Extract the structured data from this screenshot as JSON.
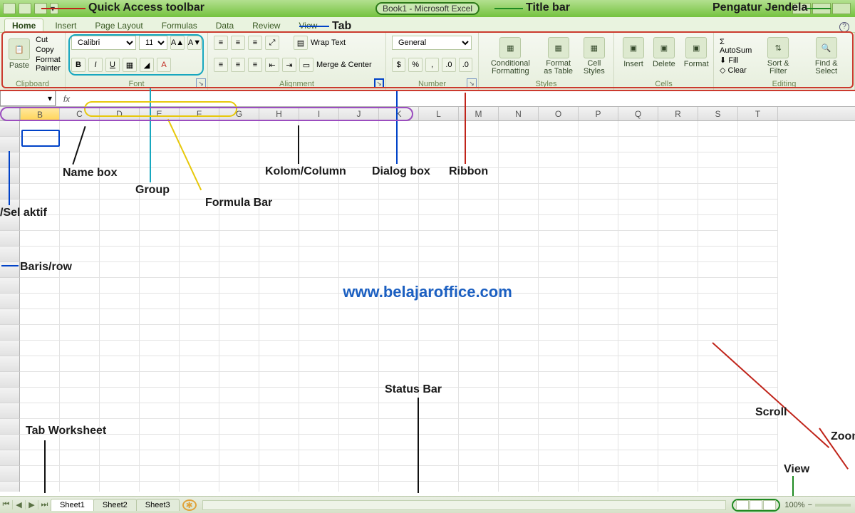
{
  "title_bar": {
    "document_title": "Book1 - Microsoft Excel",
    "qat_label_annotation": "Quick Access toolbar",
    "title_annotation": "Title bar",
    "window_controls_annotation": "Pengatur Jendela"
  },
  "tabs": {
    "annotation": "Tab",
    "items": [
      "Home",
      "Insert",
      "Page Layout",
      "Formulas",
      "Data",
      "Review",
      "View"
    ],
    "active_index": 0
  },
  "ribbon": {
    "clipboard": {
      "label": "Clipboard",
      "paste": "Paste",
      "cut": "Cut",
      "copy": "Copy",
      "format_painter": "Format Painter"
    },
    "font": {
      "label": "Font",
      "font_name": "Calibri",
      "font_size": "11",
      "bold": "B",
      "italic": "I",
      "underline": "U"
    },
    "alignment": {
      "label": "Alignment",
      "wrap_text": "Wrap Text",
      "merge_center": "Merge & Center"
    },
    "number": {
      "label": "Number",
      "format": "General"
    },
    "styles": {
      "label": "Styles",
      "conditional": "Conditional Formatting",
      "as_table": "Format as Table",
      "cell_styles": "Cell Styles"
    },
    "cells": {
      "label": "Cells",
      "insert": "Insert",
      "delete": "Delete",
      "format": "Format"
    },
    "editing": {
      "label": "Editing",
      "autosum": "AutoSum",
      "fill": "Fill",
      "clear": "Clear",
      "sort_filter": "Sort & Filter",
      "find_select": "Find & Select"
    },
    "annotation_ribbon": "Ribbon",
    "annotation_group": "Group",
    "annotation_dialog": "Dialog box"
  },
  "fx": {
    "namebox_value": "",
    "fx_symbol": "fx",
    "formula_value": "",
    "annotation_namebox": "Name box",
    "annotation_formula": "Formula Bar"
  },
  "grid": {
    "columns": [
      "B",
      "C",
      "D",
      "E",
      "F",
      "G",
      "H",
      "I",
      "J",
      "K",
      "L",
      "M",
      "N",
      "O",
      "P",
      "Q",
      "R",
      "S",
      "T"
    ],
    "selected_column_index": 0,
    "rows_visible": 24,
    "annotation_column": "Kolom/Column",
    "annotation_row": "Baris/row",
    "annotation_active_cell": "/Sel aktif",
    "watermark": "www.belajaroffice.com"
  },
  "footer": {
    "sheets": [
      "Sheet1",
      "Sheet2",
      "Sheet3"
    ],
    "active_sheet_index": 0,
    "zoom": "100%",
    "annotation_tabs": "Tab Worksheet",
    "annotation_status": "Status Bar",
    "annotation_scroll": "Scroll",
    "annotation_view": "View",
    "annotation_zoom": "Zoom"
  }
}
